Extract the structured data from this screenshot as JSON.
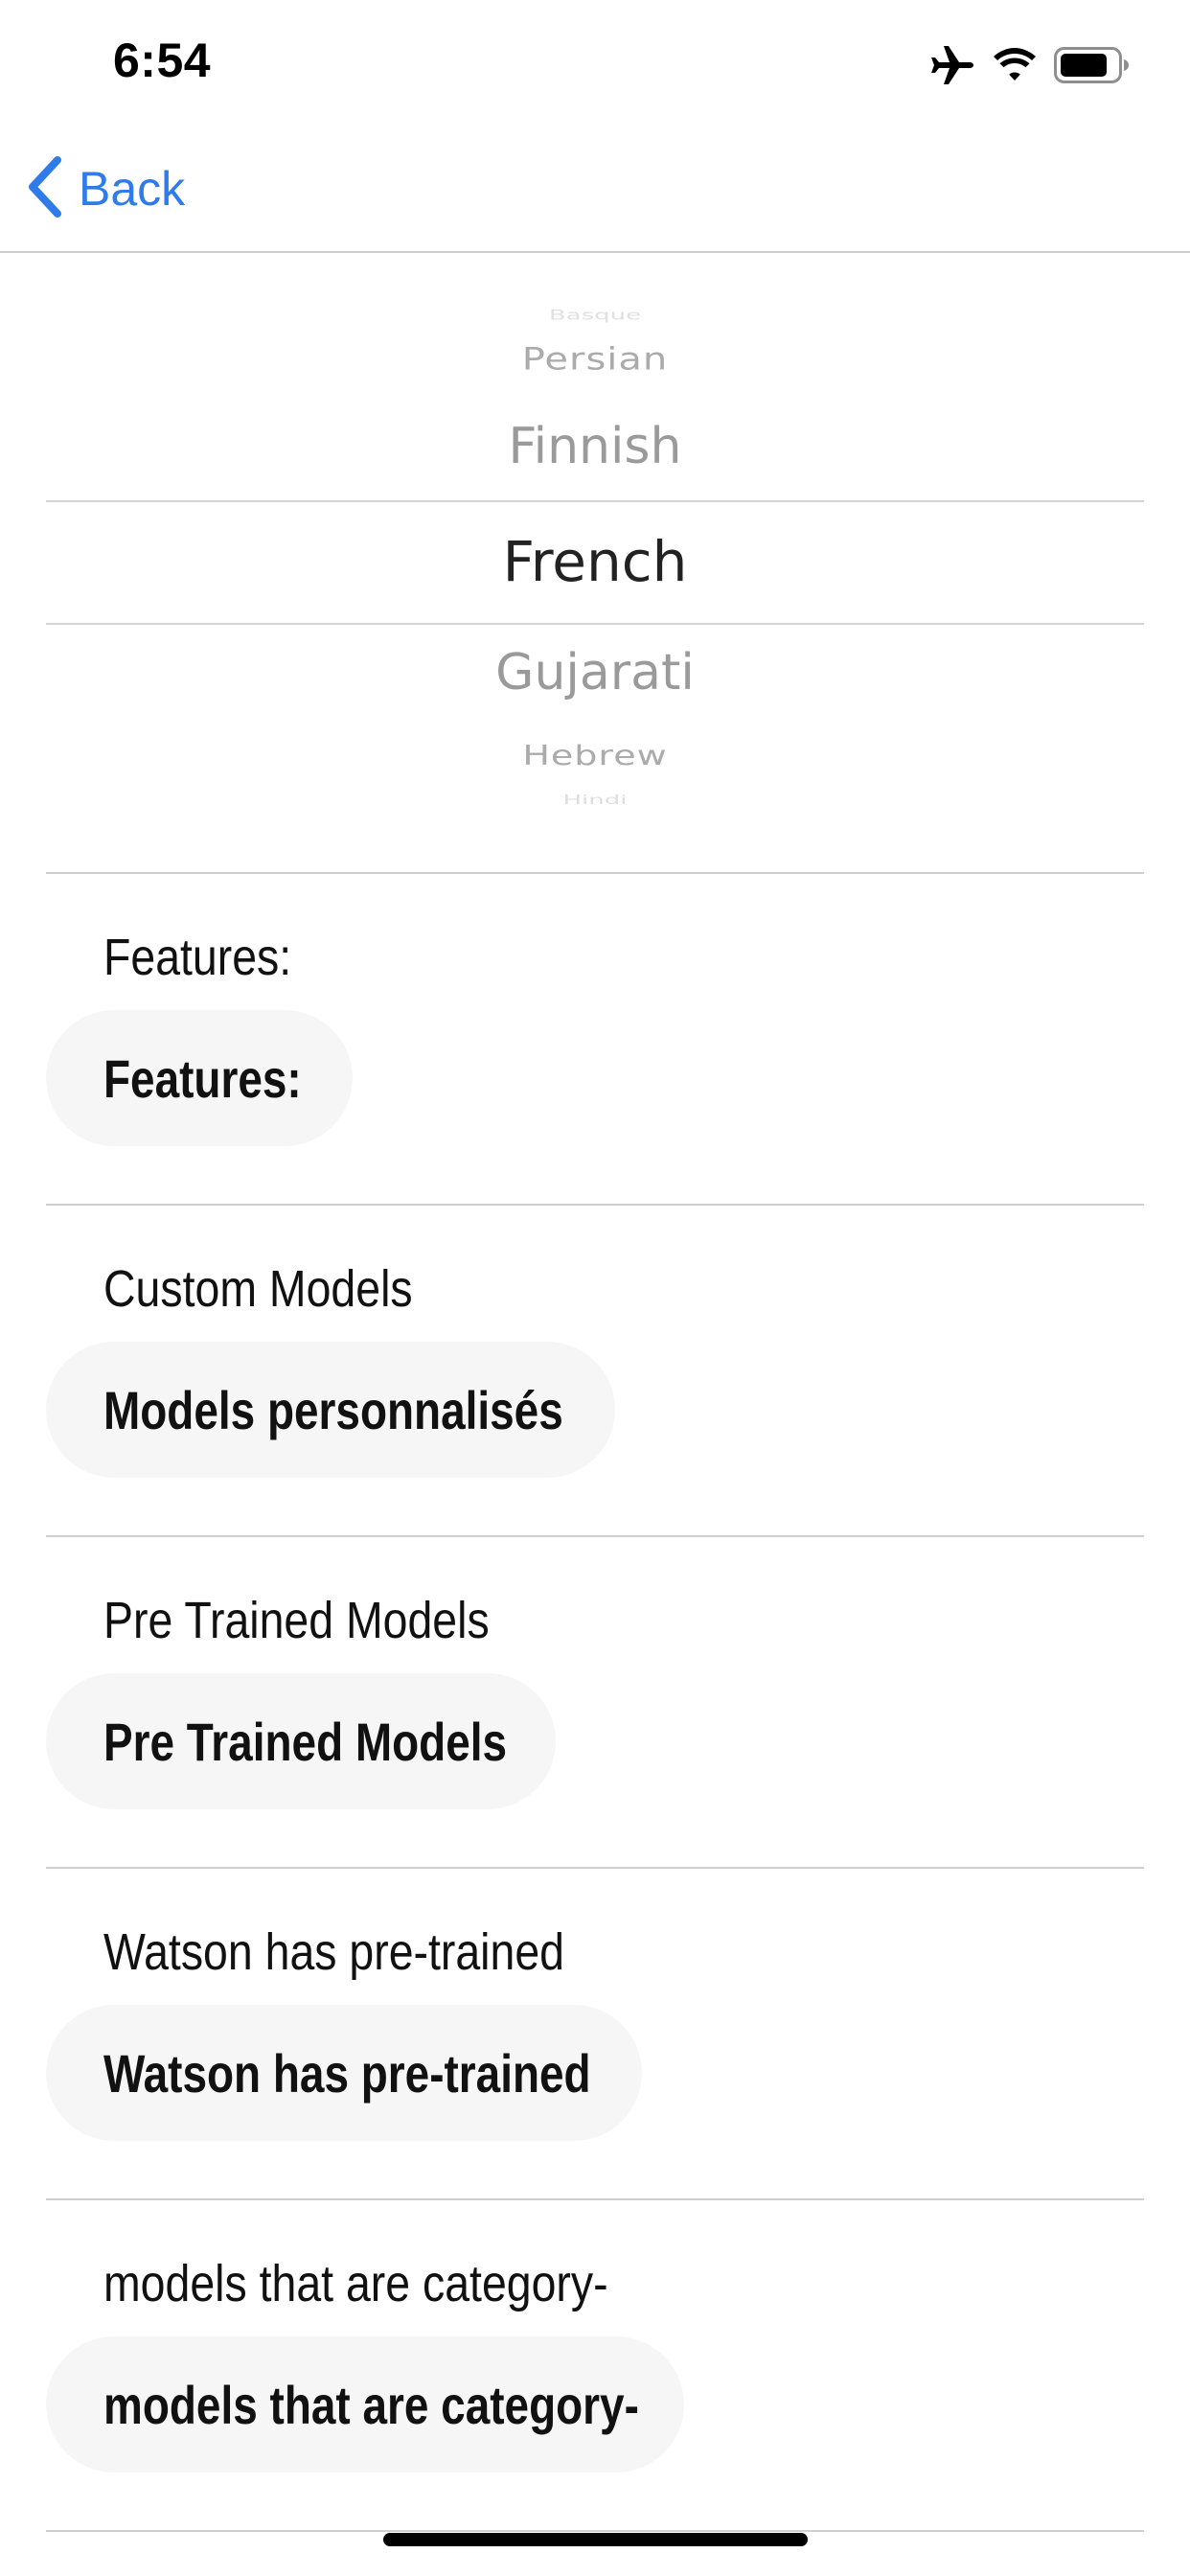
{
  "status_bar": {
    "time": "6:54",
    "icons": [
      "airplane-icon",
      "wifi-icon",
      "battery-icon"
    ]
  },
  "nav": {
    "back_label": "Back",
    "accent_color": "#2f7bea"
  },
  "picker": {
    "items": [
      "Basque",
      "Persian",
      "Finnish",
      "French",
      "Gujarati",
      "Hebrew",
      "Hindi"
    ],
    "selected": "French"
  },
  "rows": [
    {
      "label": "Features:",
      "value": "Features:"
    },
    {
      "label": "Custom Models",
      "value": "Models personnalisés"
    },
    {
      "label": "Pre Trained Models",
      "value": "Pre Trained Models"
    },
    {
      "label": "Watson has pre-trained",
      "value": "Watson has pre-trained"
    },
    {
      "label": "models that are category-",
      "value": "models that are category-"
    }
  ]
}
